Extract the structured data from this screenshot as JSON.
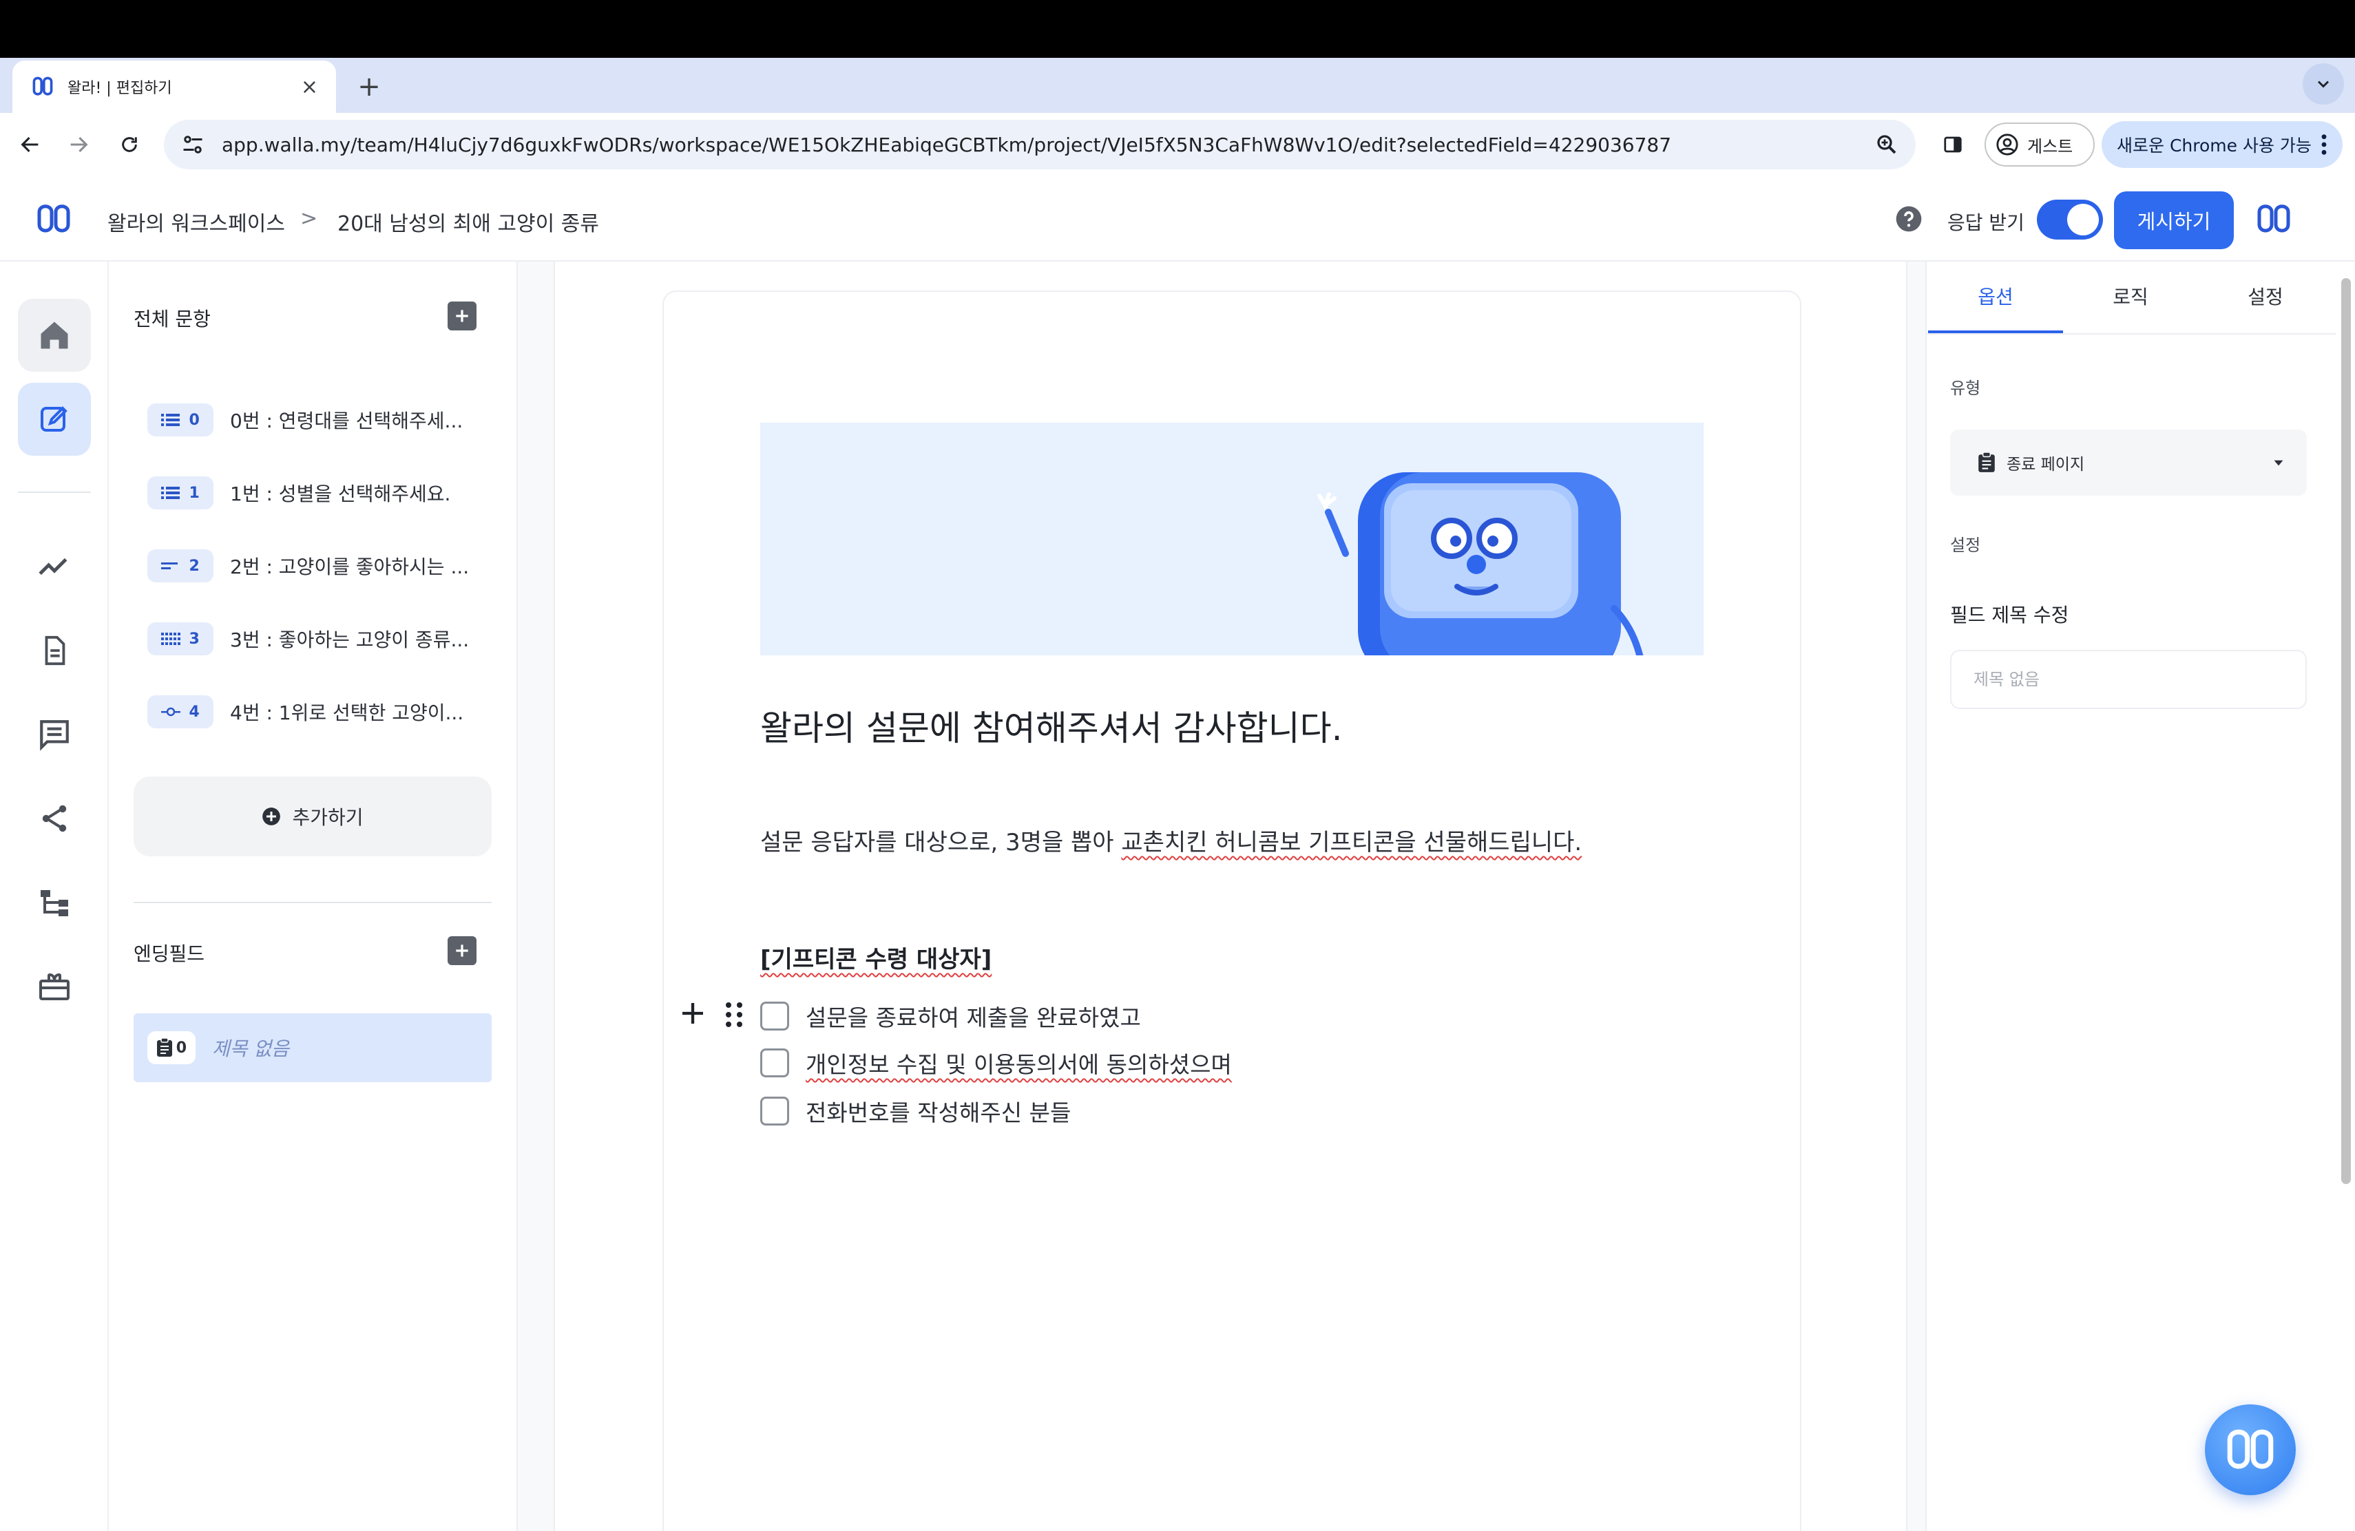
{
  "browser": {
    "tab_title": "왈라! | 편집하기",
    "url": "app.walla.my/team/H4luCjy7d6guxkFwODRs/workspace/WE15OkZHEabiqeGCBTkm/project/VJeI5fX5N3CaFhW8Wv1O/edit?selectedField=4229036787",
    "profile_label": "게스트",
    "update_label": "새로운 Chrome 사용 가능"
  },
  "header": {
    "workspace": "왈라의 워크스페이스",
    "separator": ">",
    "project": "20대 남성의 최애 고양이 종류",
    "responses_label": "응답 받기",
    "responses_on": true,
    "publish_label": "게시하기"
  },
  "fields_panel": {
    "all_questions_label": "전체 문항",
    "questions": [
      {
        "badge": "0",
        "label": "0번 : 연령대를 선택해주세...",
        "icon": "list-icon"
      },
      {
        "badge": "1",
        "label": "1번 : 성별을 선택해주세요.",
        "icon": "list-icon"
      },
      {
        "badge": "2",
        "label": "2번 : 고양이를 좋아하시는 ...",
        "icon": "short-text-icon"
      },
      {
        "badge": "3",
        "label": "3번 : 좋아하는 고양이 종류...",
        "icon": "grid-icon"
      },
      {
        "badge": "4",
        "label": "4번 : 1위로 선택한 고양이...",
        "icon": "slider-icon"
      }
    ],
    "add_label": "추가하기",
    "ending_label": "엔딩필드",
    "ending_items": [
      {
        "badge": "0",
        "label": "제목 없음",
        "icon": "clipboard-icon"
      }
    ]
  },
  "canvas": {
    "title": "왈라의 설문에 참여해주셔서 감사합니다.",
    "body_plain": "설문 응답자를 대상으로, 3명을 뽑아 ",
    "body_underlined": "교촌치킨 허니콤보 기프티콘을 선물해드립니다.",
    "gift_heading": "[기프티콘 수령 대상자]",
    "checklist": [
      "설문을 종료하여 제출을 완료하였고",
      "개인정보 수집 및 이용동의서에 동의하셨으며",
      "전화번호를 작성해주신 분들"
    ]
  },
  "right_panel": {
    "tabs": [
      "옵션",
      "로직",
      "설정"
    ],
    "active_tab": "옵션",
    "type_label": "유형",
    "type_value": "종료 페이지",
    "settings_label": "설정",
    "field_title_label": "필드 제목 수정",
    "field_title_placeholder": "제목 없음"
  },
  "colors": {
    "accent": "#2f6bef",
    "badge_bg": "#e5ecfb",
    "selected_bg": "#dbe7fd"
  }
}
